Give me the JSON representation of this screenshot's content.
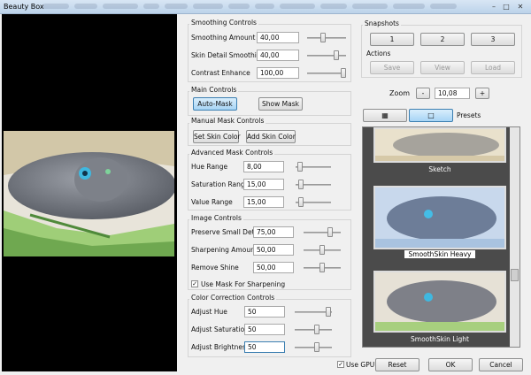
{
  "window": {
    "title": "Beauty Box"
  },
  "smoothing": {
    "title": "Smoothing Controls",
    "rows": [
      {
        "label": "Smoothing Amount",
        "value": "40,00",
        "level": 0.4
      },
      {
        "label": "Skin Detail Smoothing",
        "value": "40,00",
        "level": 0.8
      },
      {
        "label": "Contrast Enhance",
        "value": "100,00",
        "level": 1.0
      }
    ]
  },
  "main": {
    "title": "Main Controls",
    "auto_mask": "Auto-Mask",
    "show_mask": "Show Mask"
  },
  "manual": {
    "title": "Manual Mask Controls",
    "set_skin": "Set Skin Color",
    "add_skin": "Add Skin Color"
  },
  "advanced": {
    "title": "Advanced Mask Controls",
    "rows": [
      {
        "label": "Hue Range",
        "value": "8,00",
        "level": 0.05
      },
      {
        "label": "Saturation Range",
        "value": "15,00",
        "level": 0.1
      },
      {
        "label": "Value Range",
        "value": "15,00",
        "level": 0.1
      }
    ]
  },
  "image": {
    "title": "Image Controls",
    "rows": [
      {
        "label": "Preserve Small Detail",
        "value": "75,00",
        "level": 0.75
      },
      {
        "label": "Sharpening Amount",
        "value": "50,00",
        "level": 0.5
      },
      {
        "label": "Remove Shine",
        "value": "50,00",
        "level": 0.5
      }
    ],
    "use_mask": "Use Mask For Sharpening"
  },
  "color": {
    "title": "Color Correction Controls",
    "rows": [
      {
        "label": "Adjust Hue",
        "value": "50",
        "level": 0.98
      },
      {
        "label": "Adjust Saturation",
        "value": "50",
        "level": 0.6
      },
      {
        "label": "Adjust Brightness",
        "value": "50",
        "level": 0.6
      }
    ]
  },
  "snapshots": {
    "title": "Snapshots",
    "buttons": [
      "1",
      "2",
      "3"
    ],
    "actions_title": "Actions",
    "save": "Save",
    "view": "View",
    "load": "Load"
  },
  "zoom": {
    "label": "Zoom",
    "minus": "-",
    "value": "10,08",
    "plus": "+"
  },
  "presets": {
    "label": "Presets",
    "items": [
      "Sketch",
      "SmoothSkin Heavy",
      "SmoothSkin Light"
    ]
  },
  "footer": {
    "use_gpu": "Use GPU",
    "reset": "Reset",
    "ok": "OK",
    "cancel": "Cancel"
  }
}
